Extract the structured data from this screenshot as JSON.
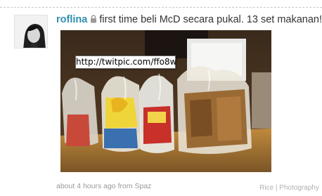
{
  "tweet": {
    "username": "roflina",
    "protected_icon": "lock-icon",
    "text": "first time beli McD secara pukal. 13 set makanan!",
    "link_tooltip": "http://twitpic.com/ffo8w",
    "timestamp": "about 4 hours ago",
    "source": "from Spaz",
    "avatar_icon": "avatar-photo"
  },
  "watermark": "Rice | Photography",
  "colors": {
    "username": "#2f8fb0",
    "text": "#333333",
    "meta": "#999999"
  }
}
